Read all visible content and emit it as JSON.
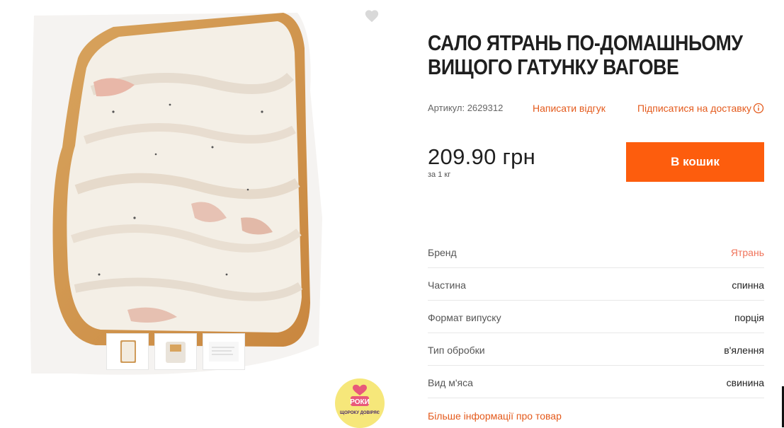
{
  "product": {
    "title": "САЛО ЯТРАНЬ ПО-ДОМАШНЬОМУ ВИЩОГО ГАТУНКУ ВАГОВЕ",
    "sku": "Артикул: 2629312",
    "review_link": "Написати відгук",
    "subscribe_link": "Підписатися на доставку",
    "price": "209.90 грн",
    "price_unit": "за 1 кг",
    "add_to_cart": "В кошик"
  },
  "specs": [
    {
      "key": "Бренд",
      "value": "Ятрань"
    },
    {
      "key": "Частина",
      "value": "спинна"
    },
    {
      "key": "Формат випуску",
      "value": "порція"
    },
    {
      "key": "Тип обробки",
      "value": "в'ялення"
    },
    {
      "key": "Вид м'яса",
      "value": "свинина"
    }
  ],
  "more_info": "Більше інформації про товар",
  "badge": {
    "top": "РОКИ",
    "bottom": "ЩОРОКУ ДОВІРЯЄ"
  },
  "icons": {
    "favorite": "heart-icon",
    "info": "info-icon"
  },
  "colors": {
    "accent": "#fd5d0d",
    "link": "#e45a1c",
    "brand_link": "#f0735a"
  }
}
